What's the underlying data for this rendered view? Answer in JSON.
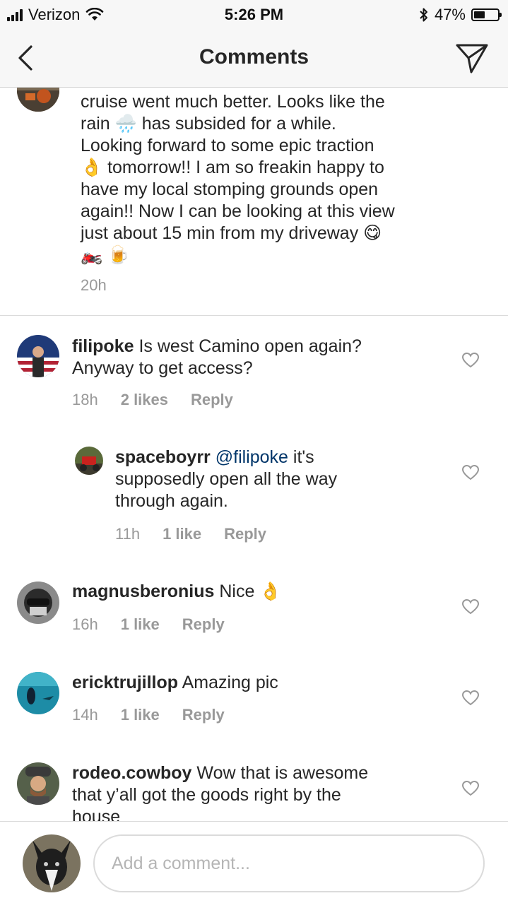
{
  "status_bar": {
    "carrier": "Verizon",
    "time": "5:26 PM",
    "battery": "47%",
    "battery_level": 0.47
  },
  "nav": {
    "title": "Comments"
  },
  "caption": {
    "lines": [
      "cruise went much better. Looks like the",
      "rain 🌧️ has subsided for a while.",
      "Looking forward to some epic traction",
      "👌 tomorrow!! I am so freakin happy to",
      "have my local stomping grounds open",
      "again!! Now I can be looking at this view",
      "just about 15 min from my driveway 😋",
      "🏍️ 🍺"
    ],
    "time": "20h"
  },
  "comments": [
    {
      "user": "filipoke",
      "text_line1": "Is west Camino open again?",
      "text_line2": "Anyway to get access?",
      "time": "18h",
      "likes": "2 likes",
      "reply": "Reply"
    },
    {
      "user": "spaceboyrr",
      "mention": "@filipoke",
      "text_line1": "it's",
      "text_line2": "supposedly open all the way",
      "text_line3": "through again.",
      "time": "11h",
      "likes": "1 like",
      "reply": "Reply"
    },
    {
      "user": "magnusberonius",
      "text_line1": "Nice 👌",
      "time": "16h",
      "likes": "1 like",
      "reply": "Reply"
    },
    {
      "user": "ericktrujillop",
      "text_line1": "Amazing pic",
      "time": "14h",
      "likes": "1 like",
      "reply": "Reply"
    },
    {
      "user": "rodeo.cowboy",
      "text_line1": "Wow that is awesome",
      "text_line2": "that y’all got the goods right by the",
      "text_line3": "house"
    }
  ],
  "composer": {
    "placeholder": "Add a comment..."
  }
}
